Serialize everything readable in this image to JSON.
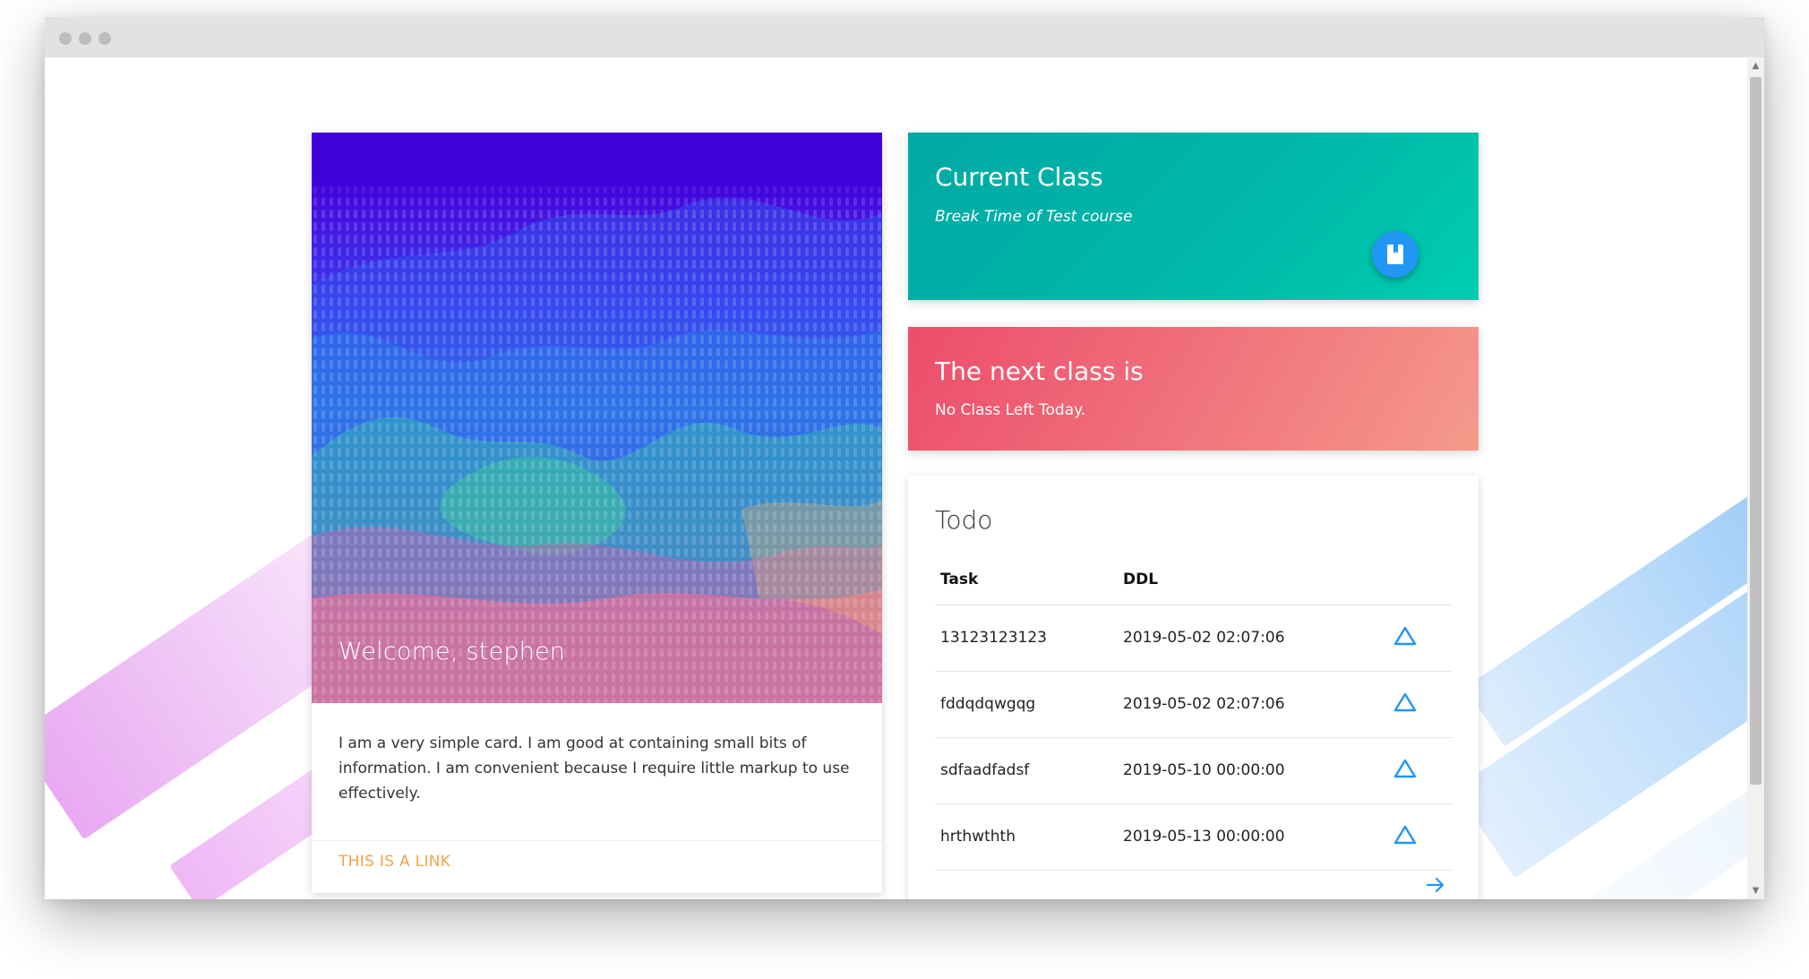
{
  "hero": {
    "title": "Welcome, stephen",
    "body": "I am a very simple card. I am good at containing small bits of information. I am convenient because I require little markup to use effectively.",
    "link": "THIS IS A LINK"
  },
  "current_class": {
    "title": "Current Class",
    "subtitle": "Break Time of Test course",
    "icon": "book-icon"
  },
  "next_class": {
    "title": "The next class is",
    "subtitle": "No Class Left Today."
  },
  "todo": {
    "title": "Todo",
    "columns": [
      "Task",
      "DDL"
    ],
    "rows": [
      {
        "task": "13123123123",
        "ddl": "2019-05-02 02:07:06"
      },
      {
        "task": "fddqdqwgqg",
        "ddl": "2019-05-02 02:07:06"
      },
      {
        "task": "sdfaadfadsf",
        "ddl": "2019-05-10 00:00:00"
      },
      {
        "task": "hrthwthth",
        "ddl": "2019-05-13 00:00:00"
      }
    ],
    "row_icon": "triangle-outline-icon",
    "more_icon": "arrow-right-icon"
  },
  "colors": {
    "current_class_bg": "#00b7a8",
    "next_class_bg": "#f06e7a",
    "fab": "#2196f3",
    "link": "#f4a24a",
    "row_icon": "#2196f3"
  }
}
